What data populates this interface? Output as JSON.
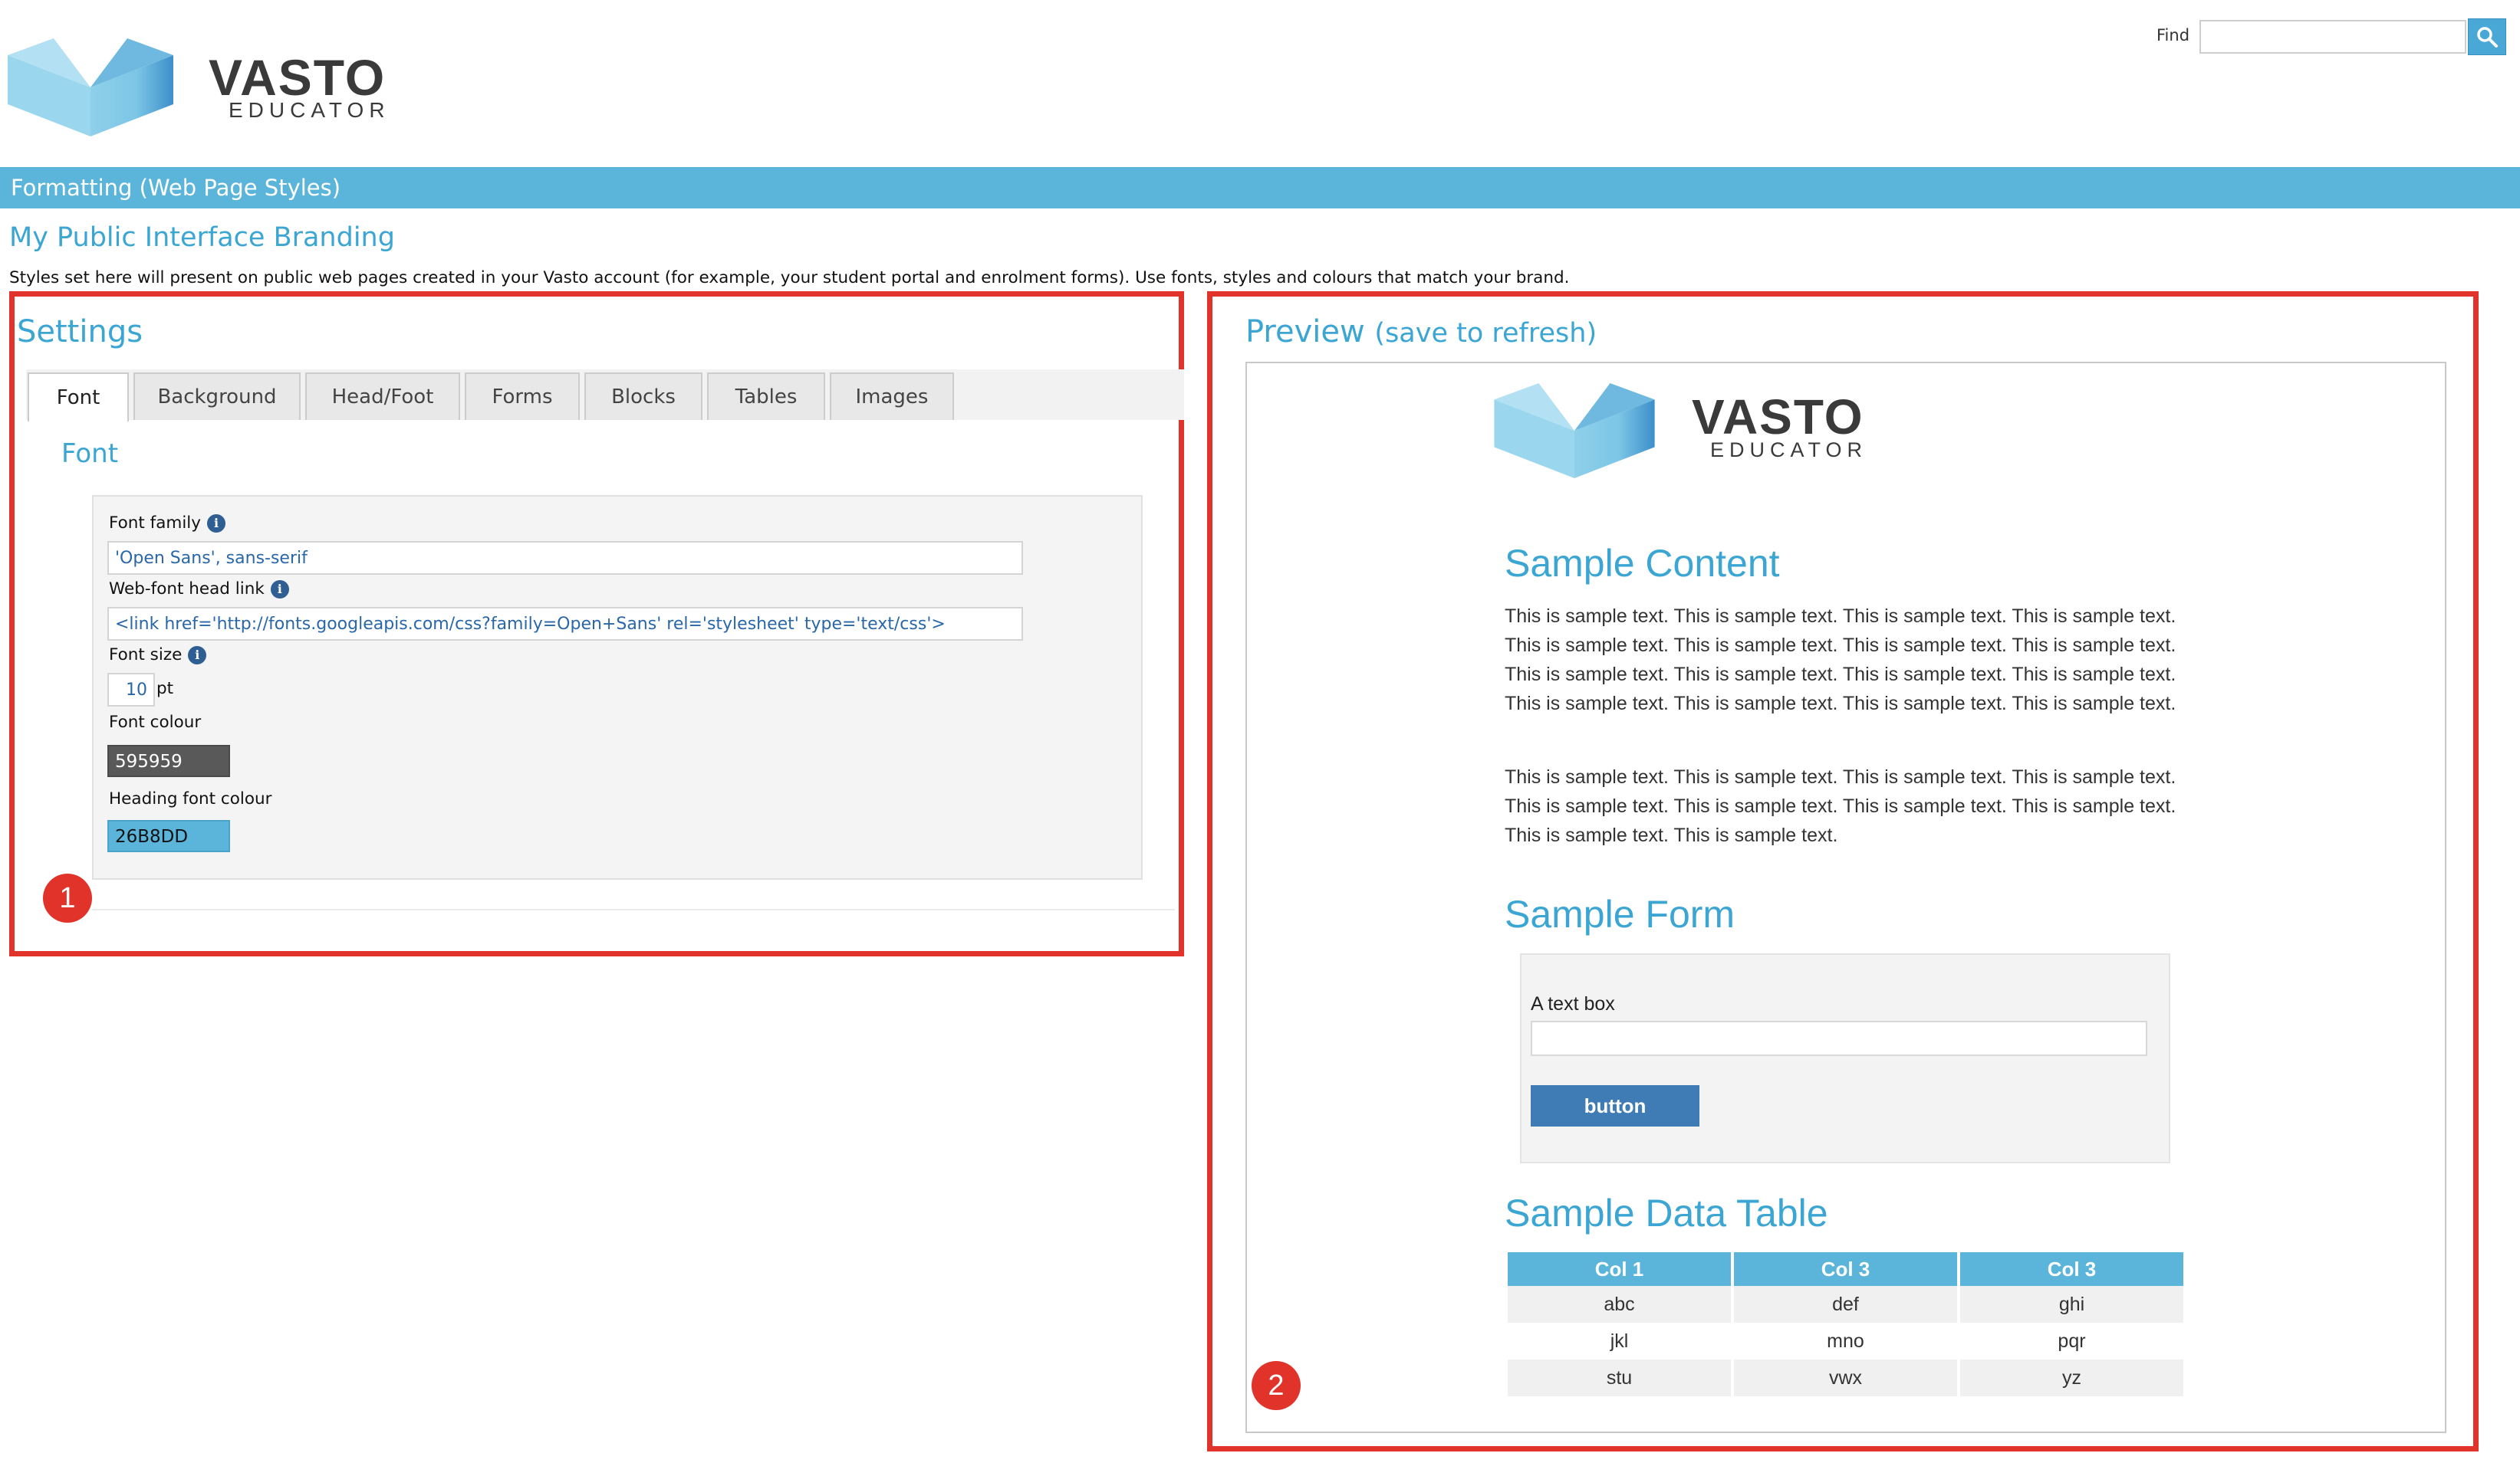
{
  "brand": {
    "name": "VASTO",
    "tagline": "EDUCATOR"
  },
  "search": {
    "label": "Find",
    "value": ""
  },
  "page": {
    "title": "Formatting (Web Page Styles)",
    "section_title": "My Public Interface Branding",
    "description": "Styles set here will present on public web pages created in your Vasto account (for example, your student portal and enrolment forms). Use fonts, styles and colours that match your brand."
  },
  "settings": {
    "title": "Settings",
    "tabs": [
      "Font",
      "Background",
      "Head/Foot",
      "Forms",
      "Blocks",
      "Tables",
      "Images"
    ],
    "active_tab": "Font",
    "section_heading": "Font",
    "fields": {
      "font_family": {
        "label": "Font family",
        "value": "'Open Sans', sans-serif"
      },
      "webfont_link": {
        "label": "Web-font head link",
        "value": "<link href='http://fonts.googleapis.com/css?family=Open+Sans' rel='stylesheet' type='text/css'>"
      },
      "font_size": {
        "label": "Font size",
        "value": "10",
        "unit": "pt"
      },
      "font_colour": {
        "label": "Font colour",
        "value": "595959",
        "color": "#595959"
      },
      "heading_font_colour": {
        "label": "Heading font colour",
        "value": "26B8DD",
        "color": "#5bb5da"
      }
    }
  },
  "preview": {
    "title": "Preview",
    "title_note": "(save to refresh)",
    "sample_content": {
      "heading": "Sample Content",
      "paragraph1": "This is sample text. This is sample text. This is sample text. This is sample text. This is sample text. This is sample text. This is sample text. This is sample text. This is sample text. This is sample text. This is sample text. This is sample text. This is sample text. This is sample text. This is sample text. This is sample text.",
      "paragraph2": "This is sample text. This is sample text. This is sample text. This is sample text. This is sample text. This is sample text. This is sample text. This is sample text. This is sample text. This is sample text."
    },
    "sample_form": {
      "heading": "Sample Form",
      "field_label": "A text box",
      "button_label": "button"
    },
    "sample_table": {
      "heading": "Sample Data Table",
      "columns": [
        "Col 1",
        "Col 3",
        "Col 3"
      ],
      "rows": [
        [
          "abc",
          "def",
          "ghi"
        ],
        [
          "jkl",
          "mno",
          "pqr"
        ],
        [
          "stu",
          "vwx",
          "yz"
        ]
      ]
    }
  },
  "annotations": [
    "1",
    "2"
  ],
  "colors": {
    "accent": "#5bb5da",
    "heading": "#3ba6d3",
    "annotation": "#e1332a",
    "button": "#3f7bb5"
  }
}
